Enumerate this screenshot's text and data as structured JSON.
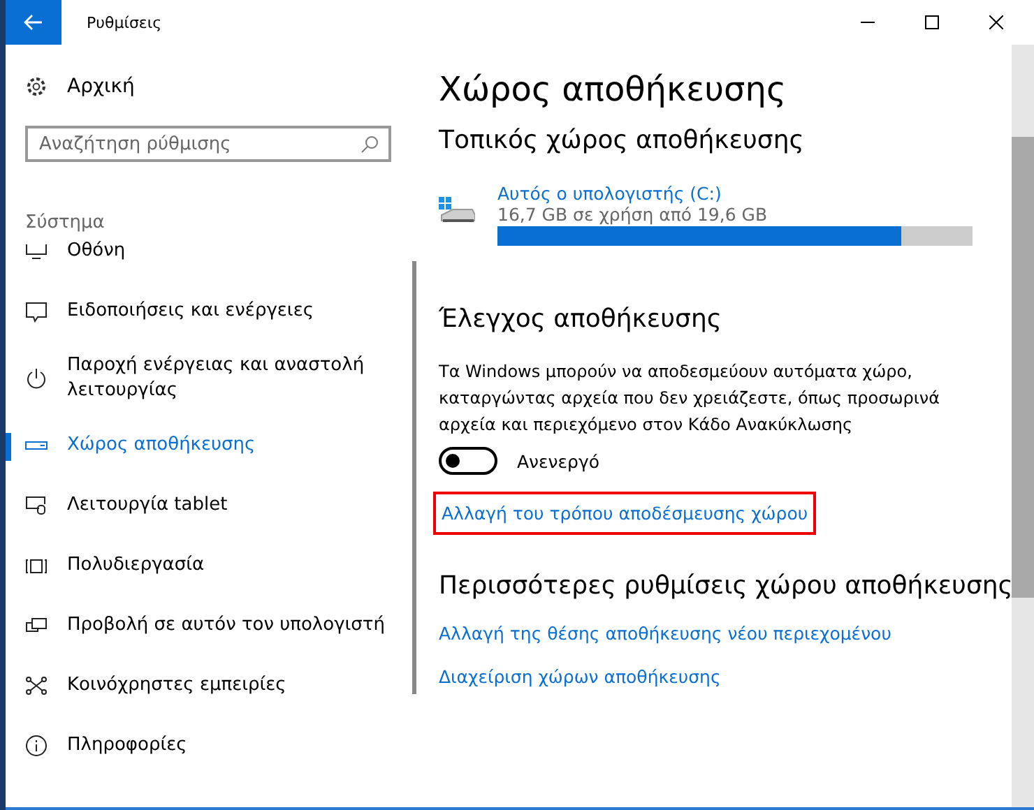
{
  "window": {
    "title": "Ρυθμίσεις"
  },
  "sidebar": {
    "home": "Αρχική",
    "search": {
      "placeholder": "Αναζήτηση ρύθμισης"
    },
    "section": "Σύστημα",
    "items": [
      {
        "kind": "display",
        "label": "Οθόνη",
        "selected": false
      },
      {
        "kind": "notifications",
        "label": "Ειδοποιήσεις και ενέργειες",
        "selected": false
      },
      {
        "kind": "power",
        "label": "Παροχή ενέργειας και αναστολή λειτουργίας",
        "selected": false
      },
      {
        "kind": "storage",
        "label": "Χώρος αποθήκευσης",
        "selected": true
      },
      {
        "kind": "tablet",
        "label": "Λειτουργία tablet",
        "selected": false
      },
      {
        "kind": "multitask",
        "label": "Πολυδιεργασία",
        "selected": false
      },
      {
        "kind": "project",
        "label": "Προβολή σε αυτόν τον υπολογιστή",
        "selected": false
      },
      {
        "kind": "shared",
        "label": "Κοινόχρηστες εμπειρίες",
        "selected": false
      },
      {
        "kind": "about",
        "label": "Πληροφορίες",
        "selected": false
      }
    ]
  },
  "main": {
    "title": "Χώρος αποθήκευσης",
    "local_heading": "Τοπικός χώρος αποθήκευσης",
    "drive": {
      "name": "Αυτός ο υπολογιστής (C:)",
      "usage": "16,7 GB σε χρήση από 19,6 GB",
      "level": 0.85
    },
    "sense": {
      "heading": "Έλεγχος αποθήκευσης",
      "description": "Τα Windows μπορούν να αποδεσμεύουν αυτόματα χώρο, καταργώντας αρχεία που δεν χρειάζεστε, όπως προσωρινά αρχεία και περιεχόμενο στον Κάδο Ανακύκλωσης",
      "toggle": {
        "on": false,
        "label": "Ανενεργό"
      },
      "link": {
        "text": "Αλλαγή του τρόπου αποδέσμευσης χώρου",
        "highlighted": true
      }
    },
    "more": {
      "heading": "Περισσότερες ρυθμίσεις χώρου αποθήκευσης",
      "links": [
        "Αλλαγή της θέσης αποθήκευσης νέου περιεχομένου",
        "Διαχείριση χώρων αποθήκευσης"
      ]
    }
  }
}
